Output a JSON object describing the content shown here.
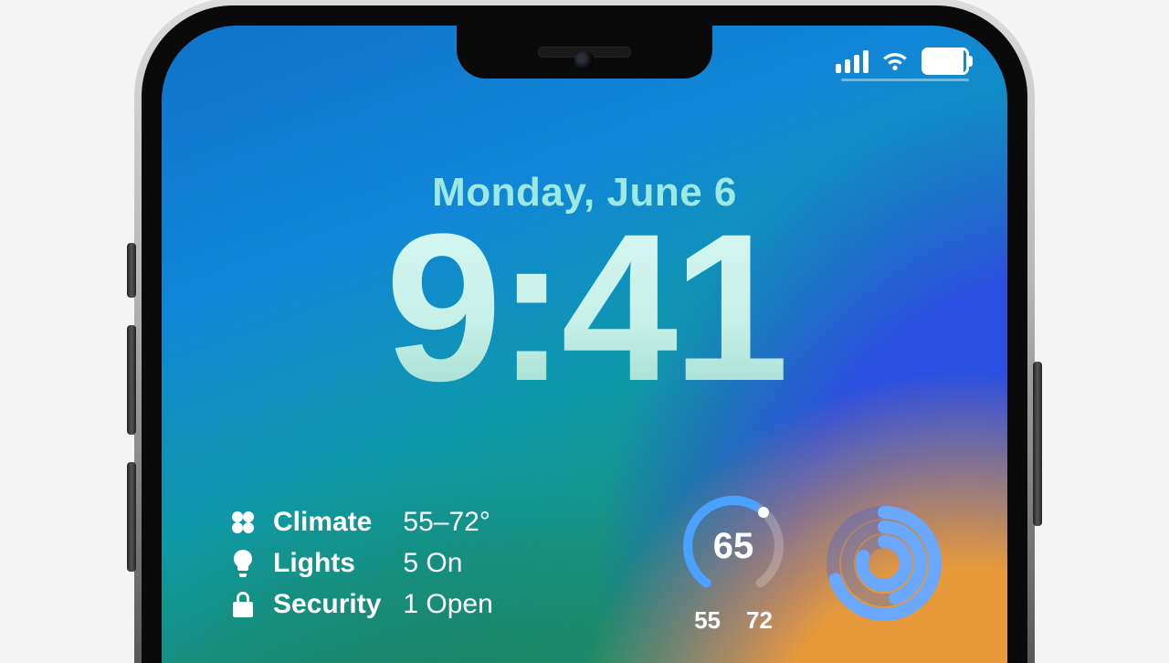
{
  "status": {
    "signal_bars": 4,
    "wifi": true,
    "battery_pct": 95
  },
  "lockscreen": {
    "date": "Monday, June 6",
    "time": "9:41"
  },
  "home_widget": {
    "rows": [
      {
        "icon": "fan",
        "label": "Climate",
        "value": "55–72°"
      },
      {
        "icon": "bulb",
        "label": "Lights",
        "value": "5 On"
      },
      {
        "icon": "lock",
        "label": "Security",
        "value": "1 Open"
      }
    ]
  },
  "weather_widget": {
    "current": "65",
    "low": "55",
    "high": "72"
  },
  "activity_widget": {
    "move_pct": 70,
    "exercise_pct": 45,
    "stand_pct": 80
  }
}
